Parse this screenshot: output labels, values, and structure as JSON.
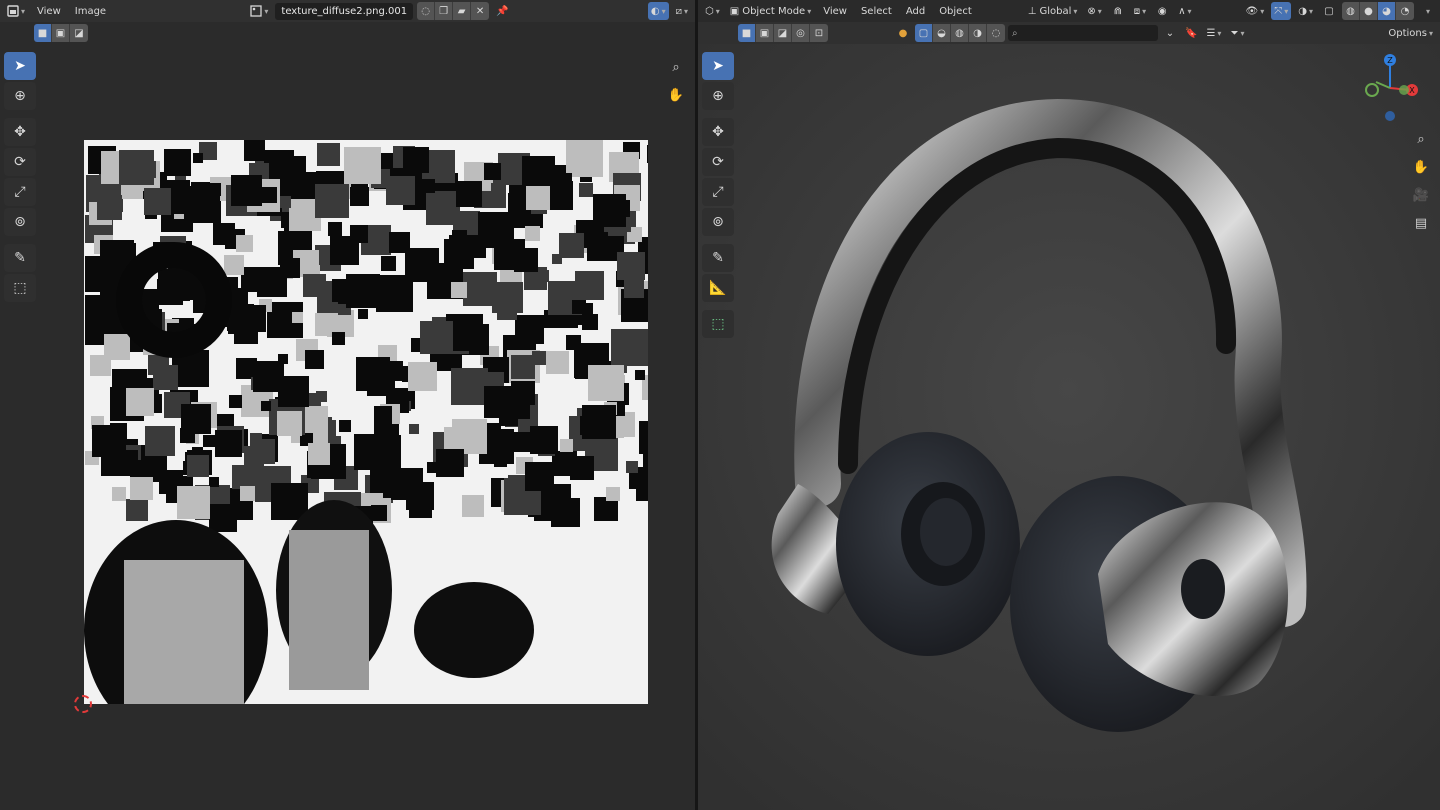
{
  "image_editor": {
    "header": {
      "editor_type_icon": "image-editor-icon",
      "menus": [
        "View",
        "Image"
      ],
      "image_name": "texture_diffuse2.png.001"
    },
    "tools": [
      "select-box-icon",
      "cursor-icon",
      "move-icon",
      "rotate-icon",
      "scale-icon",
      "transform-icon",
      "annotate-icon",
      "grab-icon"
    ]
  },
  "viewport": {
    "header": {
      "editor_type_icon": "3d-viewport-icon",
      "mode": "Object Mode",
      "menus": [
        "View",
        "Select",
        "Add",
        "Object"
      ],
      "transform_orientation": "Global",
      "options_label": "Options"
    },
    "tools": [
      "select-box-icon",
      "cursor-icon",
      "move-icon",
      "rotate-icon",
      "scale-icon",
      "transform-icon",
      "annotate-icon",
      "measure-icon",
      "add-cube-icon"
    ],
    "gizmo_axes": [
      "X",
      "Y",
      "Z"
    ]
  },
  "colors": {
    "accent": "#4772b3",
    "axis_x": "#e23a3a",
    "axis_y": "#6aa84f",
    "axis_z": "#2f7fe0",
    "viewport_bg": "#3d3d3d"
  }
}
